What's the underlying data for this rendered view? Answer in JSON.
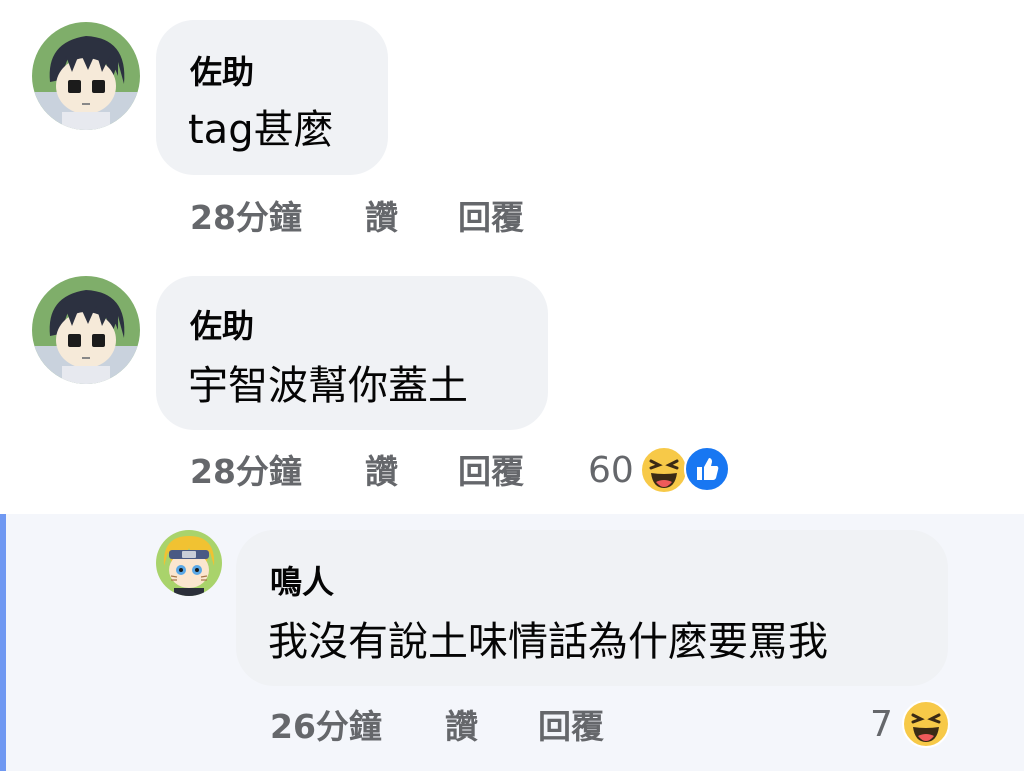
{
  "comments": [
    {
      "author": "佐助",
      "text": "tag甚麼",
      "time": "28分鐘",
      "like_label": "讚",
      "reply_label": "回覆",
      "avatar": "sasuke-avatar"
    },
    {
      "author": "佐助",
      "text": "宇智波幫你蓋土",
      "time": "28分鐘",
      "like_label": "讚",
      "reply_label": "回覆",
      "reaction_count": "60",
      "reactions": [
        "haha-icon",
        "like-icon"
      ],
      "avatar": "sasuke-avatar"
    }
  ],
  "reply": {
    "author": "鳴人",
    "text": "我沒有說土味情話為什麼要罵我",
    "time": "26分鐘",
    "like_label": "讚",
    "reply_label": "回覆",
    "reaction_count": "7",
    "reactions": [
      "haha-icon"
    ],
    "avatar": "naruto-avatar"
  },
  "colors": {
    "bubble": "#f0f2f5",
    "meta_text": "#65676b",
    "reply_highlight_bar": "#6f98f2",
    "like_blue": "#1877f2",
    "haha_yellow": "#f7c948"
  }
}
